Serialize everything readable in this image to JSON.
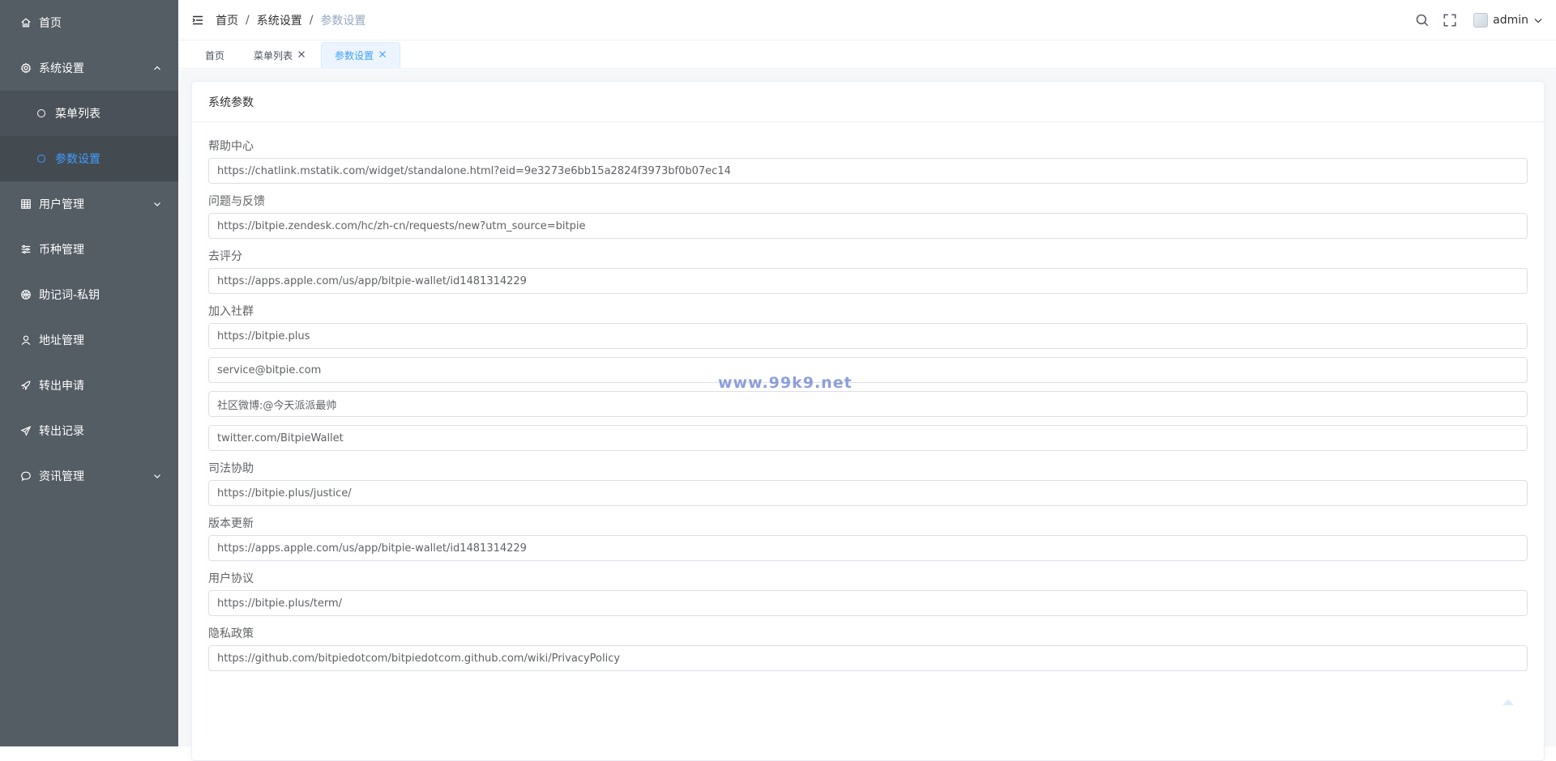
{
  "sidebar": {
    "items": [
      {
        "label": "首页",
        "icon": "home-icon"
      },
      {
        "label": "系统设置",
        "icon": "gear-icon",
        "expanded": true,
        "children": [
          {
            "label": "菜单列表",
            "active": false
          },
          {
            "label": "参数设置",
            "active": true
          }
        ]
      },
      {
        "label": "用户管理",
        "icon": "table-icon",
        "expandable": true
      },
      {
        "label": "币种管理",
        "icon": "sliders-icon"
      },
      {
        "label": "助记词-私钥",
        "icon": "basketball-icon"
      },
      {
        "label": "地址管理",
        "icon": "user-icon"
      },
      {
        "label": "转出申请",
        "icon": "rocket-icon"
      },
      {
        "label": "转出记录",
        "icon": "paper-plane-icon"
      },
      {
        "label": "资讯管理",
        "icon": "chat-icon",
        "expandable": true
      }
    ],
    "active_color": "#409eff",
    "bg_color": "#545c64"
  },
  "header": {
    "breadcrumb": [
      "首页",
      "系统设置",
      "参数设置"
    ],
    "separator": "/",
    "username": "admin"
  },
  "tags": [
    {
      "label": "首页",
      "closable": false,
      "active": false
    },
    {
      "label": "菜单列表",
      "closable": true,
      "active": false
    },
    {
      "label": "参数设置",
      "closable": true,
      "active": true
    }
  ],
  "card": {
    "title": "系统参数",
    "fields": [
      {
        "label": "帮助中心",
        "values": [
          "https://chatlink.mstatik.com/widget/standalone.html?eid=9e3273e6bb15a2824f3973bf0b07ec14"
        ]
      },
      {
        "label": "问题与反馈",
        "values": [
          "https://bitpie.zendesk.com/hc/zh-cn/requests/new?utm_source=bitpie"
        ]
      },
      {
        "label": "去评分",
        "values": [
          "https://apps.apple.com/us/app/bitpie-wallet/id1481314229"
        ]
      },
      {
        "label": "加入社群",
        "values": [
          "https://bitpie.plus",
          "service@bitpie.com",
          "社区微博:@今天派派最帅",
          "twitter.com/BitpieWallet"
        ]
      },
      {
        "label": "司法协助",
        "values": [
          "https://bitpie.plus/justice/"
        ]
      },
      {
        "label": "版本更新",
        "values": [
          "https://apps.apple.com/us/app/bitpie-wallet/id1481314229"
        ]
      },
      {
        "label": "用户协议",
        "values": [
          "https://bitpie.plus/term/"
        ]
      },
      {
        "label": "隐私政策",
        "values": [
          "https://github.com/bitpiedotcom/bitpiedotcom.github.com/wiki/PrivacyPolicy"
        ]
      }
    ]
  },
  "watermark": "www.99k9.net"
}
